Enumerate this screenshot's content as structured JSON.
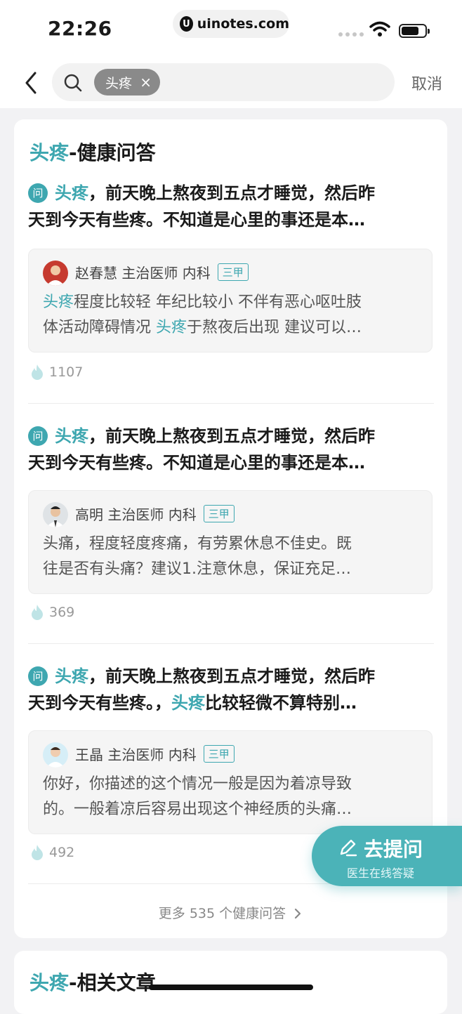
{
  "status_bar": {
    "time": "22:26",
    "url": "uinotes.com",
    "url_logo": "U"
  },
  "search": {
    "chip": "头疼",
    "chip_close": "×",
    "cancel": "取消"
  },
  "qa_card": {
    "title_hl": "头疼",
    "title_rest": "-健康问答",
    "q_badge": "问",
    "items": [
      {
        "q_hl": "头疼",
        "q_line1_rest": "，前天晚上熬夜到五点才睡觉，然后昨",
        "q_line2": "天到今天有些疼。不知道是心里的事还是本…",
        "doctor": "赵春慧 主治医师 内科",
        "tag": "三甲",
        "a1_hl": "头疼",
        "a1_rest": "程度比较轻 年纪比较小 不伴有恶心呕吐肢",
        "a2_pre": "体活动障碍情况 ",
        "a2_hl": "头疼",
        "a2_rest": "于熬夜后出现 建议可以…",
        "likes": "1107"
      },
      {
        "q_hl": "头疼",
        "q_line1_rest": "，前天晚上熬夜到五点才睡觉，然后昨",
        "q_line2": "天到今天有些疼。不知道是心里的事还是本…",
        "doctor": "高明 主治医师 内科",
        "tag": "三甲",
        "a1": "头痛，程度轻度疼痛，有劳累休息不佳史。既",
        "a2": "往是否有头痛？建议1.注意休息，保证充足…",
        "likes": "369"
      },
      {
        "q_hl": "头疼",
        "q_line1_rest": "，前天晚上熬夜到五点才睡觉，然后昨",
        "q_line2_pre": "天到今天有些疼。，",
        "q_line2_hl": "头疼",
        "q_line2_rest": "比较轻微不算特别…",
        "doctor": "王晶 主治医师 内科",
        "tag": "三甲",
        "a1": "你好，你描述的这个情况一般是因为着凉导致",
        "a2": "的。一般着凉后容易出现这个神经质的头痛…",
        "likes": "492"
      }
    ],
    "more": "更多 535 个健康问答"
  },
  "articles_card": {
    "title_hl": "头疼",
    "title_rest": "-相关文章"
  },
  "fab": {
    "title": "去提问",
    "subtitle": "医生在线答疑"
  },
  "colors": {
    "accent": "#3ea7b0",
    "fab": "#4bb3b8"
  },
  "icons": [
    "back-icon",
    "search-icon",
    "close-icon",
    "flame-icon",
    "edit-icon",
    "chevron-right-icon",
    "wifi-icon",
    "battery-icon"
  ]
}
